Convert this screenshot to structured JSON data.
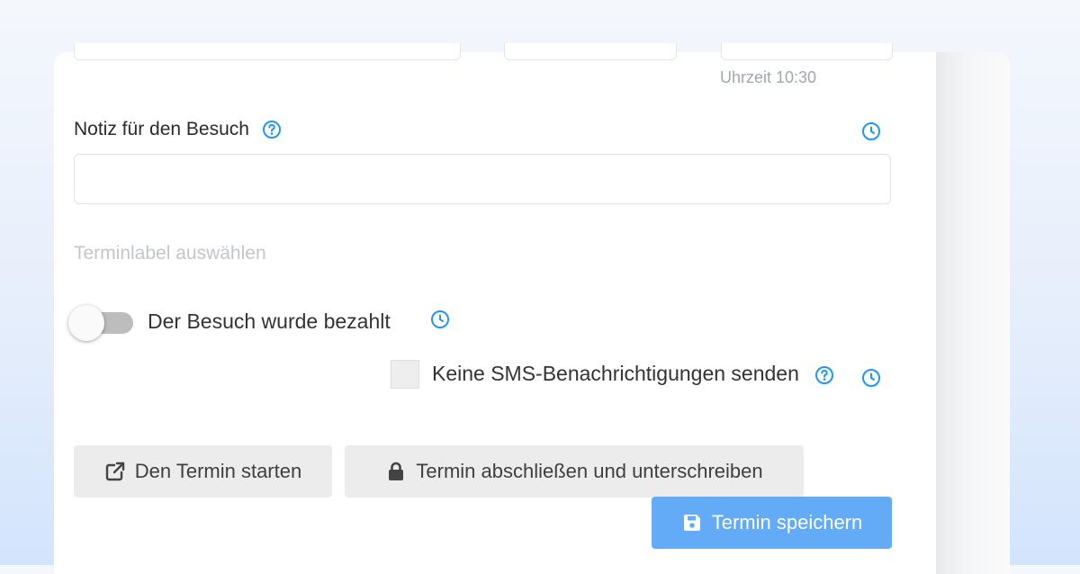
{
  "form": {
    "time_hint": "Uhrzeit 10:30",
    "note_label": "Notiz für den Besuch",
    "note_value": "",
    "label_select_placeholder": "Terminlabel auswählen",
    "paid_toggle": {
      "label": "Der Besuch wurde bezahlt",
      "on": false
    },
    "sms_checkbox": {
      "label": "Keine SMS-Benachrichtigungen senden",
      "checked": false
    }
  },
  "actions": {
    "start_label": "Den Termin starten",
    "finish_label": "Termin abschließen und unterschreiben",
    "save_label": "Termin speichern"
  },
  "icons": {
    "help": "question-circle-icon",
    "history": "clock-icon",
    "start": "external-link-icon",
    "finish": "lock-icon",
    "save": "floppy-disk-icon"
  },
  "colors": {
    "accent": "#2196f3",
    "primary_button": "#64abf7",
    "secondary_button": "#ececec",
    "toggle_track": "#bdbdbd"
  }
}
